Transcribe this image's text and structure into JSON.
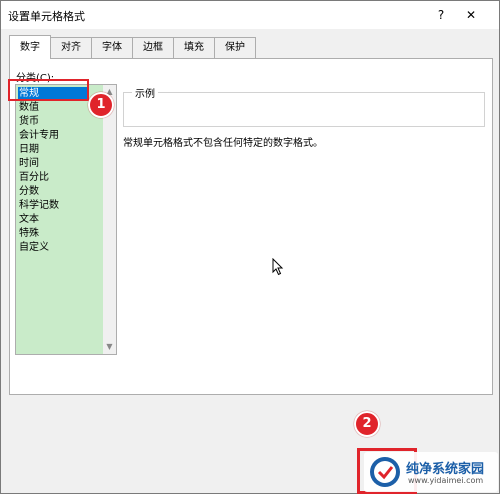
{
  "window": {
    "title": "设置单元格格式",
    "help": "?",
    "close": "✕"
  },
  "tabs": [
    {
      "label": "数字",
      "active": true
    },
    {
      "label": "对齐"
    },
    {
      "label": "字体"
    },
    {
      "label": "边框"
    },
    {
      "label": "填充"
    },
    {
      "label": "保护"
    }
  ],
  "category": {
    "label": "分类(C):",
    "selected": "常规",
    "items": [
      "常规",
      "数值",
      "货币",
      "会计专用",
      "日期",
      "时间",
      "百分比",
      "分数",
      "科学记数",
      "文本",
      "特殊",
      "自定义"
    ]
  },
  "sample": {
    "label": "示例"
  },
  "description": "常规单元格格式不包含任何特定的数字格式。",
  "annotations": {
    "badge1": "1",
    "badge2": "2",
    "highlight_color": "#e0242b"
  },
  "watermark": {
    "text": "纯净系统家园",
    "url": "www.yidaimei.com"
  },
  "colors": {
    "list_bg": "#c9ebc9",
    "selection": "#0078d7"
  }
}
